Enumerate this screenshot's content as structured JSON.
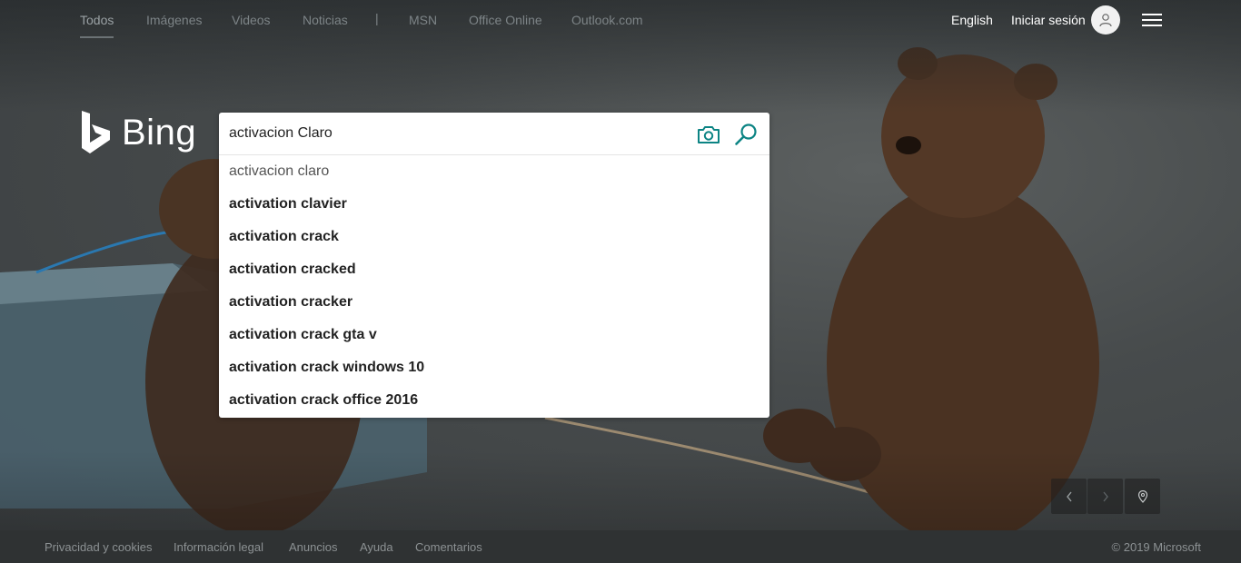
{
  "nav": {
    "links": [
      {
        "label": "Todos"
      },
      {
        "label": "Imágenes"
      },
      {
        "label": "Videos"
      },
      {
        "label": "Noticias"
      },
      {
        "label": "MSN"
      },
      {
        "label": "Office Online"
      },
      {
        "label": "Outlook.com"
      }
    ],
    "separator": "|",
    "language": "English",
    "signin": "Iniciar sesión"
  },
  "logo": {
    "text": "Bing"
  },
  "search": {
    "value": "activacion Claro",
    "suggestions": [
      "activacion claro",
      "activation clavier",
      "activation crack",
      "activation cracked",
      "activation cracker",
      "activation crack gta v",
      "activation crack windows 10",
      "activation crack office 2016"
    ]
  },
  "footer": {
    "links": [
      "Privacidad y cookies",
      "Información legal",
      "Anuncios",
      "Ayuda",
      "Comentarios"
    ],
    "copyright": "© 2019 Microsoft"
  },
  "icons": {
    "camera": "camera-icon",
    "search": "magnifier-icon",
    "user": "user-icon",
    "menu": "hamburger-icon",
    "prev": "chevron-left-icon",
    "next": "chevron-right-icon",
    "location": "location-pin-icon"
  },
  "colors": {
    "accent": "#0c8484",
    "nav_text": "#7d8487",
    "footer_bg": "#2f3233"
  }
}
